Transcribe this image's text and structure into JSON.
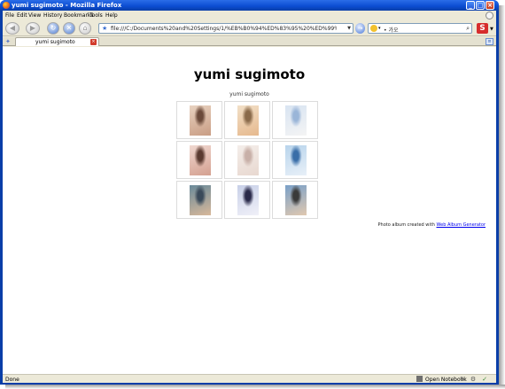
{
  "window": {
    "title": "yumi sugimoto - Mozilla Firefox",
    "minimize_glyph": "_",
    "maximize_glyph": "□",
    "close_glyph": "×"
  },
  "menu": {
    "items": [
      "File",
      "Edit",
      "View",
      "History",
      "Bookmarks",
      "Tools",
      "Help"
    ]
  },
  "navigation": {
    "url": "file:///C:/Documents%20and%20Settings/1/%EB%B0%94%ED%83%95%20%ED%99%94%EB%A9%B4/yumisu",
    "search_text": "• 가오"
  },
  "tab": {
    "label": "yumi sugimoto"
  },
  "page": {
    "title": "yumi sugimoto",
    "caption": "yumi sugimoto",
    "credit_prefix": "Photo album created with ",
    "credit_link": "Web Album Generator",
    "thumbnails": [
      {
        "colors": [
          "#e8d2c0",
          "#6b4a3a",
          "#c99d84"
        ]
      },
      {
        "colors": [
          "#f2e0c8",
          "#8a6a4a",
          "#e6b98e"
        ]
      },
      {
        "colors": [
          "#d8e4f2",
          "#9ab5d8",
          "#f4f4f4"
        ]
      },
      {
        "colors": [
          "#f0d8d0",
          "#5a3a30",
          "#d4a090"
        ]
      },
      {
        "colors": [
          "#f4eeea",
          "#c8b0a8",
          "#e8d8d0"
        ]
      },
      {
        "colors": [
          "#b8d4ec",
          "#3a6ea8",
          "#e8f0f8"
        ]
      },
      {
        "colors": [
          "#6a8a9a",
          "#3a4a5a",
          "#d8b89a"
        ]
      },
      {
        "colors": [
          "#c8d0e8",
          "#2a2a4a",
          "#f0f0f8"
        ]
      },
      {
        "colors": [
          "#7aa0c8",
          "#3a3a3a",
          "#e0c8b0"
        ]
      }
    ]
  },
  "status": {
    "text": "Done",
    "notebook_label": "Open Notebook"
  }
}
